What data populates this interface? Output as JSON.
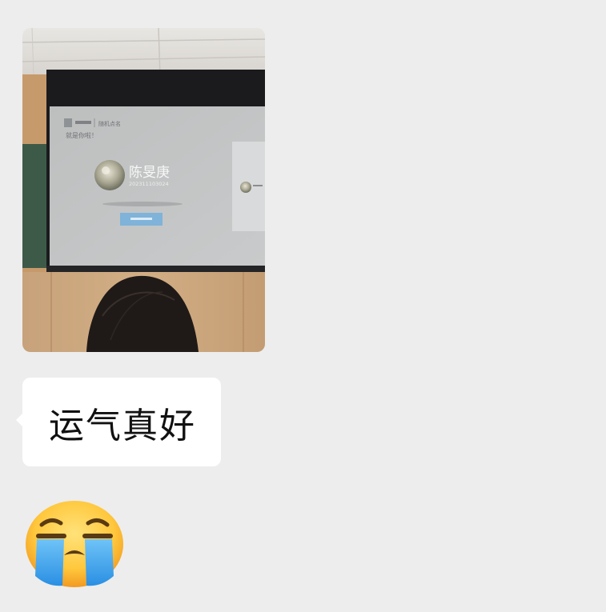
{
  "messages": [
    {
      "type": "image",
      "photo": {
        "slide_header": "随机点名",
        "slide_subtitle": "就是你啦！",
        "student_name": "陈旻庚",
        "student_id": "202311103024"
      }
    },
    {
      "type": "text",
      "text": "运气真好"
    },
    {
      "type": "sticker",
      "icon": "crying-face-icon"
    }
  ],
  "colors": {
    "chat_background": "#ededed",
    "bubble_background": "#ffffff",
    "bubble_text": "#111111"
  }
}
